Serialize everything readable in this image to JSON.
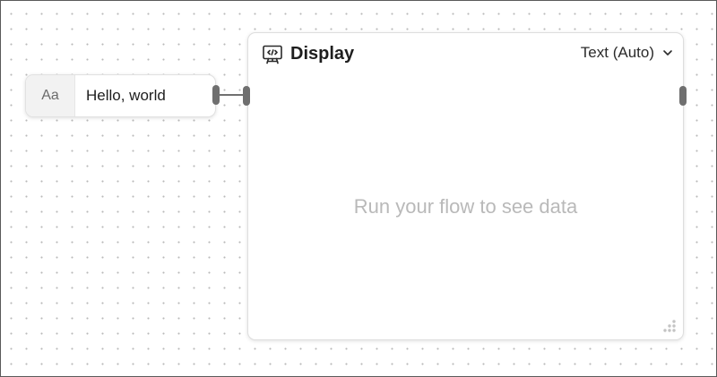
{
  "text_node": {
    "type_icon": "Aa",
    "value": "Hello, world"
  },
  "display_node": {
    "icon": "display-code-icon",
    "title": "Display",
    "mode": "Text (Auto)",
    "placeholder": "Run your flow to see data"
  },
  "colors": {
    "handle": "#6f6f6f",
    "placeholder_text": "#b9b9b9",
    "canvas_dot": "#b9b9b9"
  }
}
